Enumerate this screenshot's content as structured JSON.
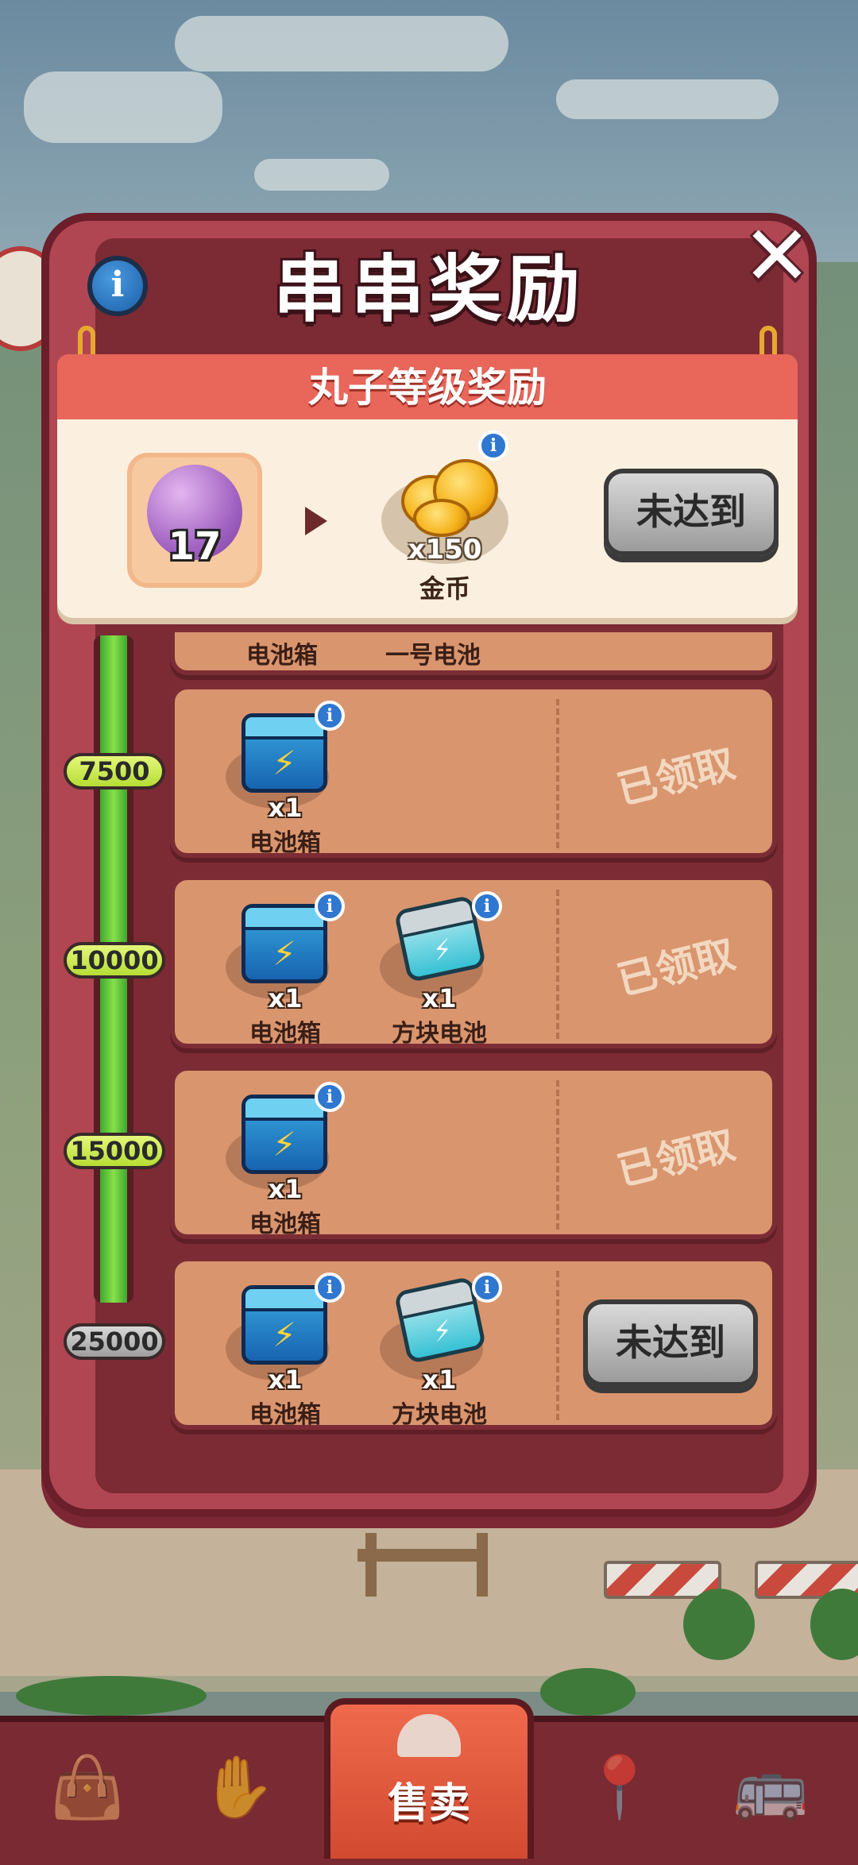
{
  "dialog": {
    "title": "串串奖励",
    "info_icon": "info-icon",
    "close_icon": "close-icon"
  },
  "level_reward": {
    "header": "丸子等级奖励",
    "level": "17",
    "reward_qty": "x150",
    "reward_name": "金币",
    "button": "未达到"
  },
  "partial_row": {
    "items": [
      "电池箱",
      "一号电池"
    ]
  },
  "rows": [
    {
      "threshold": "7500",
      "items": [
        {
          "qty": "x1",
          "name": "电池箱"
        }
      ],
      "status": "已领取"
    },
    {
      "threshold": "10000",
      "items": [
        {
          "qty": "x1",
          "name": "电池箱"
        },
        {
          "qty": "x1",
          "name": "方块电池"
        }
      ],
      "status": "已领取"
    },
    {
      "threshold": "15000",
      "items": [
        {
          "qty": "x1",
          "name": "电池箱"
        }
      ],
      "status": "已领取"
    },
    {
      "threshold": "25000",
      "items": [
        {
          "qty": "x1",
          "name": "电池箱"
        },
        {
          "qty": "x1",
          "name": "方块电池"
        }
      ],
      "button": "未达到"
    }
  ],
  "nav": {
    "items": [
      {
        "icon": "bag-icon"
      },
      {
        "icon": "hands-icon"
      },
      {
        "icon": "bell-icon",
        "label": "售卖"
      },
      {
        "icon": "map-pin-icon"
      },
      {
        "icon": "bus-icon"
      }
    ]
  },
  "colors": {
    "panel": "#b04652",
    "ribbon": "#e8665a",
    "progress": "#5fc93a",
    "row": "#d9956e"
  }
}
